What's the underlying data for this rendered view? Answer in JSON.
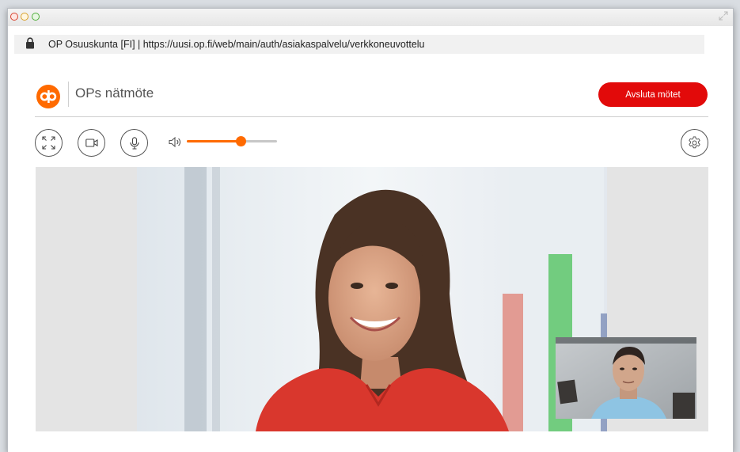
{
  "window": {
    "traffic_lights": [
      "close",
      "minimize",
      "maximize"
    ]
  },
  "address_bar": {
    "icon": "lock-icon",
    "text": "OP Osuuskunta [FI] | https://uusi.op.fi/web/main/auth/asiakaspalvelu/verkkoneuvottelu"
  },
  "header": {
    "logo_icon": "op-logo-icon",
    "title": "OPs nätmöte",
    "end_button": "Avsluta mötet"
  },
  "controls": {
    "fullscreen_icon": "fullscreen-icon",
    "camera_icon": "video-camera-icon",
    "microphone_icon": "microphone-icon",
    "volume_icon": "speaker-icon",
    "volume_level": 0.6,
    "settings_icon": "gear-icon"
  },
  "colors": {
    "brand_orange": "#ff6a00",
    "end_button_red": "#e20a0a"
  }
}
